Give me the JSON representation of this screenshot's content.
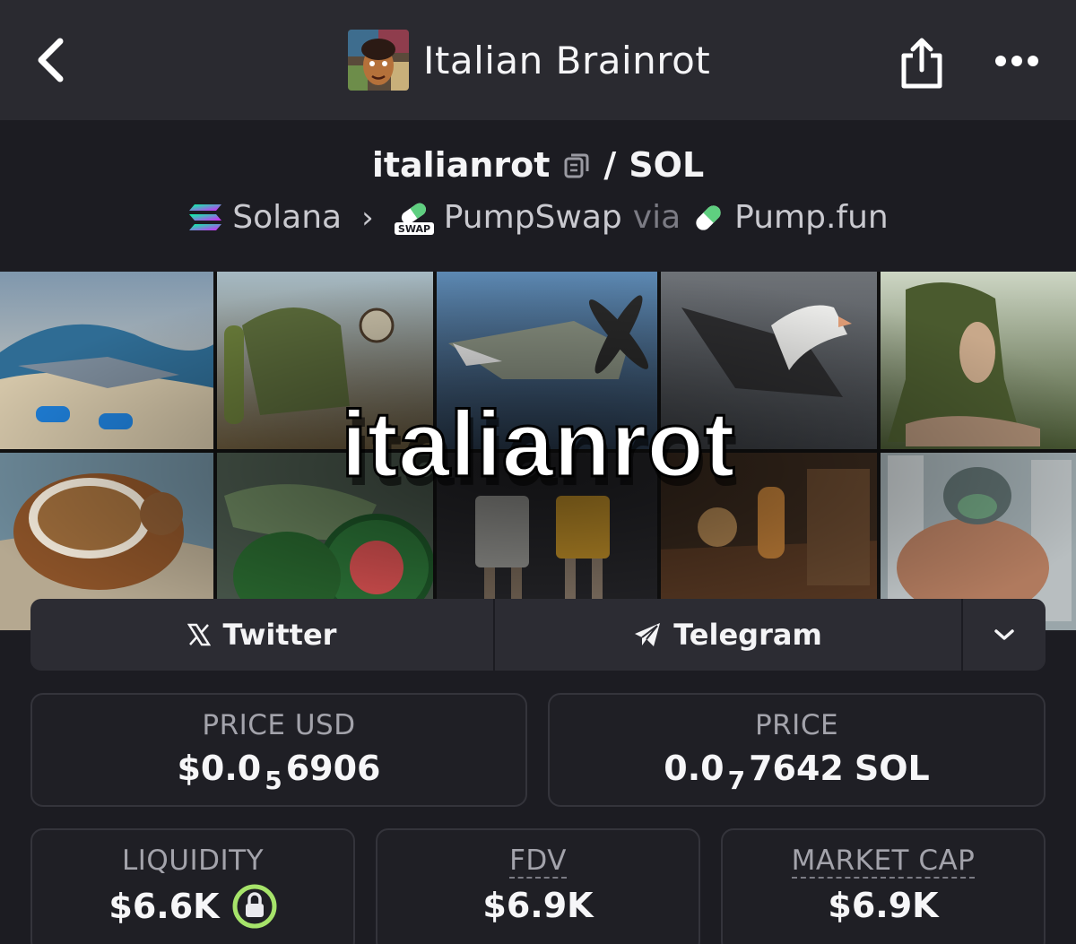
{
  "header": {
    "title": "Italian Brainrot",
    "back_icon": "chevron-left-icon",
    "share_icon": "share-icon",
    "more_icon": "more-horizontal-icon"
  },
  "pair": {
    "base": "italianrot",
    "separator": "/",
    "quote": "SOL"
  },
  "route": {
    "chain": "Solana",
    "dex": "PumpSwap",
    "via_label": "via",
    "launchpad": "Pump.fun",
    "dex_badge": "SWAP"
  },
  "banner": {
    "text": "italianrot"
  },
  "social": {
    "twitter_label": "Twitter",
    "telegram_label": "Telegram"
  },
  "stats": {
    "price_usd": {
      "label": "PRICE USD",
      "prefix": "$0.0",
      "zeros": "5",
      "digits": "6906"
    },
    "price_sol": {
      "label": "PRICE",
      "prefix": "0.0",
      "zeros": "7",
      "digits": "7642",
      "unit": "SOL"
    },
    "liquidity": {
      "label": "LIQUIDITY",
      "value": "$6.6K"
    },
    "fdv": {
      "label": "FDV",
      "value": "$6.9K"
    },
    "market_cap": {
      "label": "MARKET CAP",
      "value": "$6.9K"
    }
  },
  "colors": {
    "header_bg": "#2a2a30",
    "page_bg": "#1c1c22",
    "card_border": "#34343b",
    "lock_green": "#a6e36a"
  }
}
